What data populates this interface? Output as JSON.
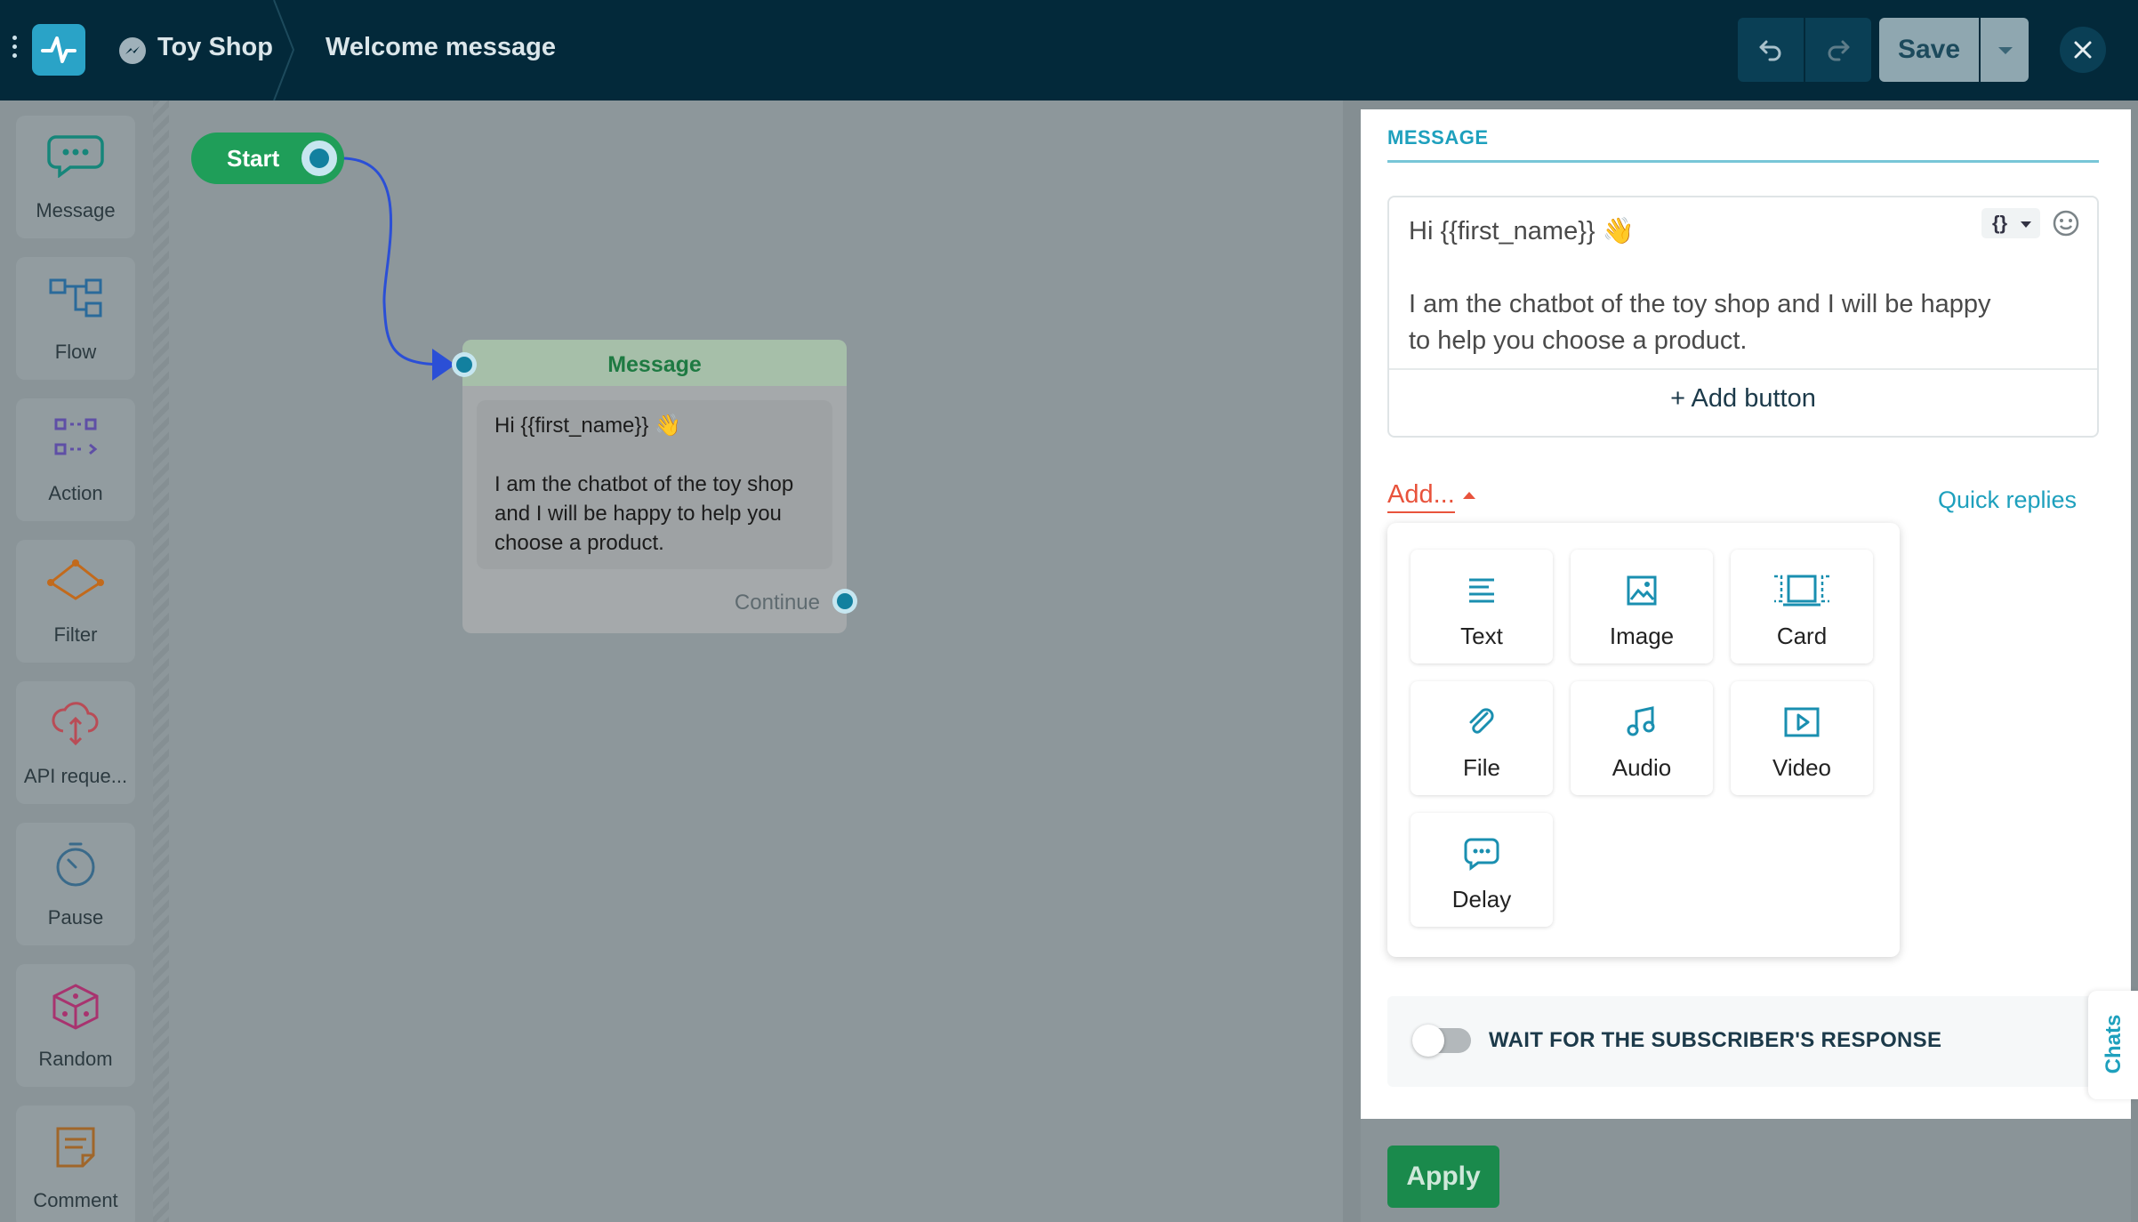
{
  "topbar": {
    "bot_name": "Toy Shop",
    "flow_name": "Welcome message",
    "save_label": "Save",
    "icons": [
      "menu-dots-icon",
      "logo-icon",
      "messenger-icon",
      "undo-icon",
      "redo-icon",
      "chevron-down-icon",
      "close-icon"
    ]
  },
  "sidebar": {
    "items": [
      {
        "label": "Message",
        "icon": "message-icon",
        "color": "#16867a"
      },
      {
        "label": "Flow",
        "icon": "flow-icon",
        "color": "#2a6a9a"
      },
      {
        "label": "Action",
        "icon": "action-icon",
        "color": "#5f4fa6"
      },
      {
        "label": "Filter",
        "icon": "filter-icon",
        "color": "#c26a1c"
      },
      {
        "label": "API reque...",
        "icon": "api-icon",
        "color": "#b94c56"
      },
      {
        "label": "Pause",
        "icon": "pause-icon",
        "color": "#3a6a8a"
      },
      {
        "label": "Random",
        "icon": "random-icon",
        "color": "#a8336f"
      },
      {
        "label": "Comment",
        "icon": "comment-icon",
        "color": "#a0662a"
      }
    ]
  },
  "canvas": {
    "start_label": "Start",
    "node": {
      "title": "Message",
      "text": "Hi {{first_name}} 👋\n\nI am the chatbot of the toy shop and I will be happy to help you choose a product.",
      "continue_label": "Continue"
    }
  },
  "panel": {
    "section_title": "MESSAGE",
    "editor_text": "Hi {{first_name}} 👋\n\nI am the chatbot of the toy shop and I will be happy to help you choose a product.",
    "variable_btn": "{}",
    "add_button_label": "+ Add button",
    "add_menu_label": "Add...",
    "quick_replies_label": "Quick replies",
    "content_types": [
      {
        "label": "Text",
        "icon": "text-icon"
      },
      {
        "label": "Image",
        "icon": "image-icon"
      },
      {
        "label": "Card",
        "icon": "card-icon"
      },
      {
        "label": "File",
        "icon": "paperclip-icon"
      },
      {
        "label": "Audio",
        "icon": "music-note-icon"
      },
      {
        "label": "Video",
        "icon": "video-icon"
      },
      {
        "label": "Delay",
        "icon": "typing-bubble-icon"
      }
    ],
    "wait_label": "WAIT FOR THE SUBSCRIBER'S RESPONSE",
    "wait_enabled": false,
    "chats_tab": "Chats",
    "apply_label": "Apply"
  },
  "colors": {
    "topbar": "#03293a",
    "accent": "#1ea0bd",
    "start_green": "#1f9e59",
    "add_red": "#e8533c",
    "apply_green": "#1a8a4c"
  }
}
